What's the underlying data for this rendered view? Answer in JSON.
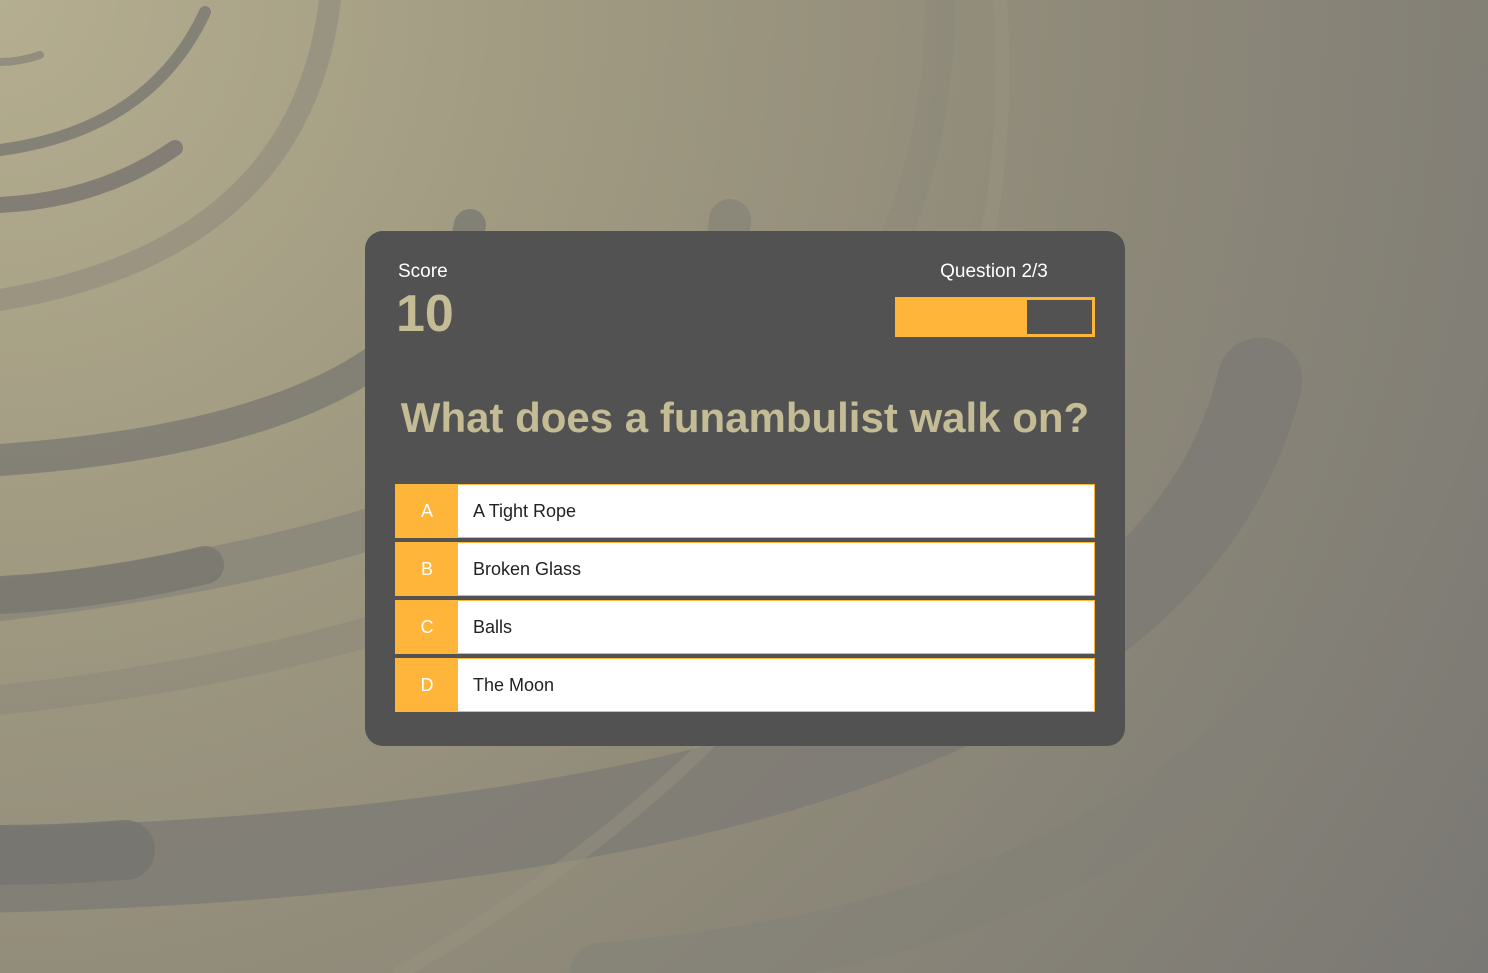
{
  "colors": {
    "card_background": "#525252",
    "accent": "#ffb43a",
    "muted_gold": "#c4bc95",
    "answer_background": "#ffffff"
  },
  "score": {
    "label": "Score",
    "value": "10"
  },
  "progress": {
    "label": "Question 2/3",
    "fraction": 0.667
  },
  "question": {
    "text": "What does a funambulist walk on?"
  },
  "answers": [
    {
      "letter": "A",
      "text": "A Tight Rope"
    },
    {
      "letter": "B",
      "text": "Broken Glass"
    },
    {
      "letter": "C",
      "text": "Balls"
    },
    {
      "letter": "D",
      "text": "The Moon"
    }
  ]
}
